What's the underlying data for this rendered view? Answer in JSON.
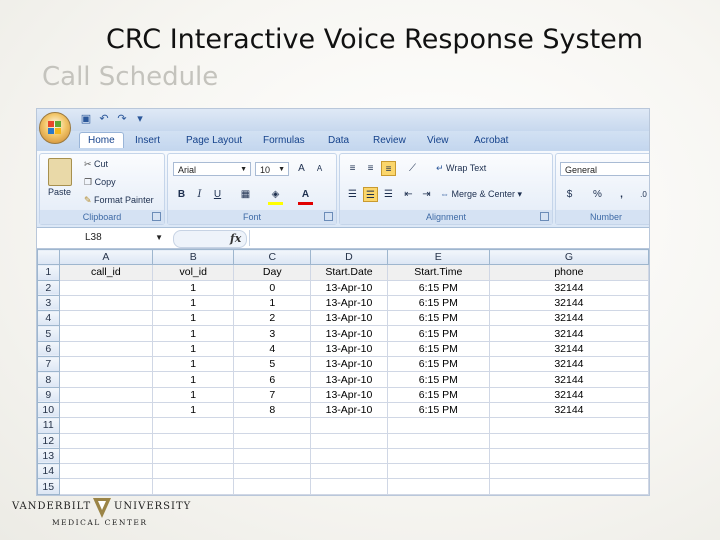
{
  "slide": {
    "title": "CRC Interactive Voice Response System",
    "subtitle": "Call Schedule"
  },
  "ribbon": {
    "tabs": [
      "Home",
      "Insert",
      "Page Layout",
      "Formulas",
      "Data",
      "Review",
      "View",
      "Acrobat"
    ],
    "clipboard": {
      "paste": "Paste",
      "cut": "Cut",
      "copy": "Copy",
      "format_painter": "Format Painter",
      "label": "Clipboard"
    },
    "font": {
      "name": "Arial",
      "size": "10",
      "label": "Font"
    },
    "alignment": {
      "wrap_text": "Wrap Text",
      "merge_center": "Merge & Center",
      "label": "Alignment"
    },
    "number": {
      "format": "General",
      "currency": "$",
      "percent": "%",
      "label": "Number"
    }
  },
  "formula_bar": {
    "name_box": "L38",
    "fx": "fx"
  },
  "sheet": {
    "column_letters": [
      "A",
      "B",
      "C",
      "D",
      "E",
      "G"
    ],
    "row_numbers": [
      "1",
      "2",
      "3",
      "4",
      "5",
      "6",
      "7",
      "8",
      "9",
      "10",
      "11",
      "12",
      "13",
      "14",
      "15"
    ],
    "header": [
      "call_id",
      "vol_id",
      "Day",
      "Start.Date",
      "Start.Time",
      "phone"
    ],
    "rows": [
      [
        "",
        "1",
        "0",
        "13-Apr-10",
        "6:15 PM",
        "32144"
      ],
      [
        "",
        "1",
        "1",
        "13-Apr-10",
        "6:15 PM",
        "32144"
      ],
      [
        "",
        "1",
        "2",
        "13-Apr-10",
        "6:15 PM",
        "32144"
      ],
      [
        "",
        "1",
        "3",
        "13-Apr-10",
        "6:15 PM",
        "32144"
      ],
      [
        "",
        "1",
        "4",
        "13-Apr-10",
        "6:15 PM",
        "32144"
      ],
      [
        "",
        "1",
        "5",
        "13-Apr-10",
        "6:15 PM",
        "32144"
      ],
      [
        "",
        "1",
        "6",
        "13-Apr-10",
        "6:15 PM",
        "32144"
      ],
      [
        "",
        "1",
        "7",
        "13-Apr-10",
        "6:15 PM",
        "32144"
      ],
      [
        "",
        "1",
        "8",
        "13-Apr-10",
        "6:15 PM",
        "32144"
      ]
    ]
  },
  "footer": {
    "logo_left": "VANDERBILT",
    "logo_right": "UNIVERSITY",
    "logo_sub": "MEDICAL CENTER"
  }
}
